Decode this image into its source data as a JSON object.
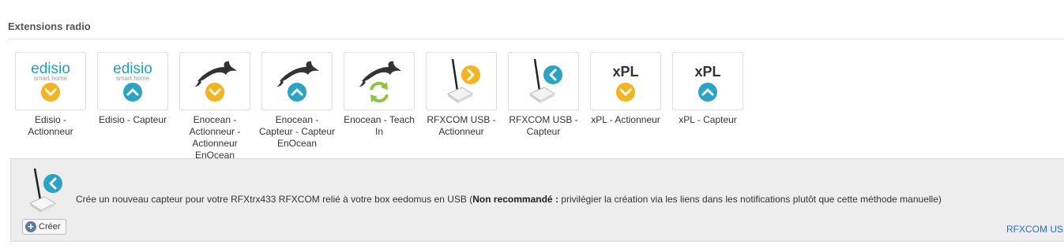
{
  "section": {
    "title": "Extensions radio"
  },
  "tiles": [
    {
      "label": "Edisio - Actionneur",
      "brand": "edisio",
      "brand_sub": "smart home",
      "icon": "chevron-down-icon"
    },
    {
      "label": "Edisio - Capteur",
      "brand": "edisio",
      "brand_sub": "smart home",
      "icon": "chevron-up-icon"
    },
    {
      "label": "Enocean - Actionneur - Actionneur EnOcean",
      "icon": "chevron-down-icon"
    },
    {
      "label": "Enocean - Capteur - Capteur EnOcean",
      "icon": "chevron-up-icon"
    },
    {
      "label": "Enocean - Teach In",
      "icon": "refresh-icon"
    },
    {
      "label": "RFXCOM USB - Actionneur",
      "icon": "chevron-right-icon"
    },
    {
      "label": "RFXCOM USB - Capteur",
      "icon": "chevron-left-icon"
    },
    {
      "label": "xPL - Actionneur",
      "brand": "xPL",
      "icon": "chevron-down-icon"
    },
    {
      "label": "xPL - Capteur",
      "brand": "xPL",
      "icon": "chevron-up-icon"
    }
  ],
  "panel": {
    "text_before": "Crée un nouveau capteur pour votre RFXtrx433 RFXCOM relié à votre box eedomus en USB (",
    "text_bold": "Non recommandé :",
    "text_after": " privilégier la création via les liens dans les notifications plutôt que cette méthode manuelle)",
    "create_label": "Créer",
    "link_label": "RFXCOM USB"
  },
  "colors": {
    "orange": "#f5b31c",
    "teal": "#2aa4c4",
    "green": "#8dc63f",
    "link": "#2a6ebb"
  }
}
